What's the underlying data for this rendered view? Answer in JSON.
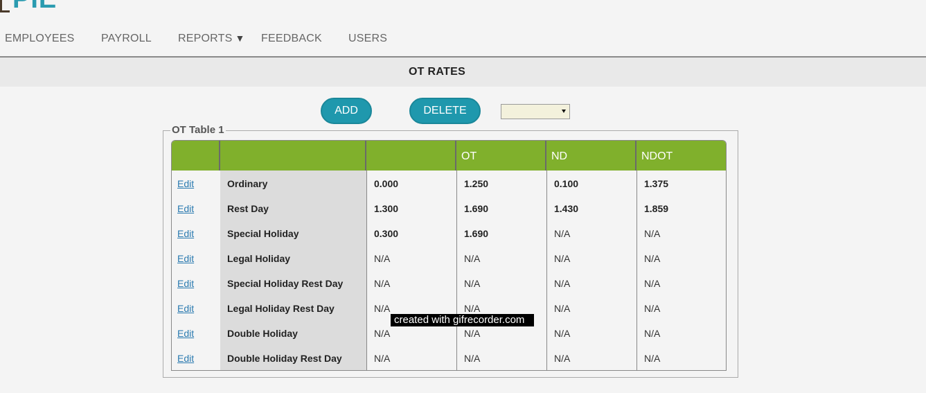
{
  "logo": {
    "text": "PIE"
  },
  "nav": {
    "items": [
      {
        "label": "EMPLOYEES"
      },
      {
        "label": "PAYROLL"
      },
      {
        "label": "REPORTS",
        "has_dropdown": true,
        "caret": "▼"
      },
      {
        "label": "FEEDBACK"
      },
      {
        "label": "USERS"
      }
    ]
  },
  "page": {
    "title": "OT RATES"
  },
  "toolbar": {
    "add_label": "ADD",
    "delete_label": "DELETE",
    "table_select_value": ""
  },
  "fieldset": {
    "legend": "OT Table 1"
  },
  "table": {
    "headers": [
      "",
      "",
      "",
      "OT",
      "ND",
      "NDOT"
    ],
    "edit_label": "Edit",
    "rows": [
      {
        "label": "Ordinary",
        "values": [
          "0.000",
          "1.250",
          "0.100",
          "1.375"
        ],
        "bold": [
          true,
          true,
          true,
          true
        ]
      },
      {
        "label": "Rest Day",
        "values": [
          "1.300",
          "1.690",
          "1.430",
          "1.859"
        ],
        "bold": [
          true,
          true,
          true,
          true
        ]
      },
      {
        "label": "Special Holiday",
        "values": [
          "0.300",
          "1.690",
          "N/A",
          "N/A"
        ],
        "bold": [
          true,
          true,
          false,
          false
        ]
      },
      {
        "label": "Legal Holiday",
        "values": [
          "N/A",
          "N/A",
          "N/A",
          "N/A"
        ],
        "bold": [
          false,
          false,
          false,
          false
        ]
      },
      {
        "label": "Special Holiday Rest Day",
        "values": [
          "N/A",
          "N/A",
          "N/A",
          "N/A"
        ],
        "bold": [
          false,
          false,
          false,
          false
        ]
      },
      {
        "label": "Legal Holiday Rest Day",
        "values": [
          "N/A",
          "N/A",
          "N/A",
          "N/A"
        ],
        "bold": [
          false,
          false,
          false,
          false
        ]
      },
      {
        "label": "Double Holiday",
        "values": [
          "N/A",
          "N/A",
          "N/A",
          "N/A"
        ],
        "bold": [
          false,
          false,
          false,
          false
        ]
      },
      {
        "label": "Double Holiday Rest Day",
        "values": [
          "N/A",
          "N/A",
          "N/A",
          "N/A"
        ],
        "bold": [
          false,
          false,
          false,
          false
        ]
      }
    ]
  },
  "watermark": {
    "text": "created with gifrecorder.com"
  },
  "colors": {
    "header_green": "#80b02c",
    "button_teal": "#1f98ad",
    "link_blue": "#2a7ab0"
  }
}
